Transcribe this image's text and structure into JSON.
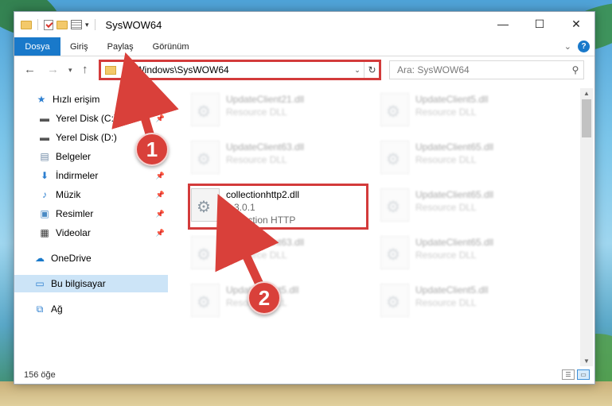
{
  "window": {
    "title": "SysWOW64",
    "minimize": "—",
    "maximize": "☐",
    "close": "✕"
  },
  "ribbon": {
    "tabs": [
      "Dosya",
      "Giriş",
      "Paylaş",
      "Görünüm"
    ],
    "help": "?"
  },
  "address": {
    "path": "C:\\Windows\\SysWOW64",
    "search_placeholder": "Ara: SysWOW64"
  },
  "sidebar": {
    "items": [
      {
        "label": "Hızlı erişim",
        "icon": "star-icon"
      },
      {
        "label": "Yerel Disk (C:)",
        "icon": "drive-icon"
      },
      {
        "label": "Yerel Disk (D:)",
        "icon": "drive-icon"
      },
      {
        "label": "Belgeler",
        "icon": "documents-icon"
      },
      {
        "label": "İndirmeler",
        "icon": "download-icon"
      },
      {
        "label": "Müzik",
        "icon": "music-icon"
      },
      {
        "label": "Resimler",
        "icon": "pictures-icon"
      },
      {
        "label": "Videolar",
        "icon": "video-icon"
      },
      {
        "label": "OneDrive",
        "icon": "cloud-icon"
      },
      {
        "label": "Bu bilgisayar",
        "icon": "computer-icon"
      },
      {
        "label": "Ağ",
        "icon": "network-icon"
      }
    ]
  },
  "files": [
    {
      "name": "UpdateClient21.dll",
      "sub1": "Resource DLL",
      "sub2": ""
    },
    {
      "name": "UpdateClient5.dll",
      "sub1": "Resource DLL",
      "sub2": ""
    },
    {
      "name": "UpdateClient63.dll",
      "sub1": "Resource DLL",
      "sub2": ""
    },
    {
      "name": "UpdateClient65.dll",
      "sub1": "Resource DLL",
      "sub2": ""
    },
    {
      "name": "collectionhttp2.dll",
      "sub1": "6.3.0.1",
      "sub2": "Collection HTTP"
    },
    {
      "name": "UpdateClient65.dll",
      "sub1": "Resource DLL",
      "sub2": ""
    },
    {
      "name": "UpdateClient63.dll",
      "sub1": "Resource DLL",
      "sub2": ""
    },
    {
      "name": "UpdateClient65.dll",
      "sub1": "Resource DLL",
      "sub2": ""
    },
    {
      "name": "UpdateClient5.dll",
      "sub1": "Resource DLL",
      "sub2": ""
    },
    {
      "name": "UpdateClient5.dll",
      "sub1": "Resource DLL",
      "sub2": ""
    }
  ],
  "status": {
    "count": "156 öğe"
  },
  "markers": {
    "one": "1",
    "two": "2"
  },
  "colors": {
    "accent": "#1979ca",
    "highlight": "#d33b3b",
    "selected": "#cce4f7"
  }
}
